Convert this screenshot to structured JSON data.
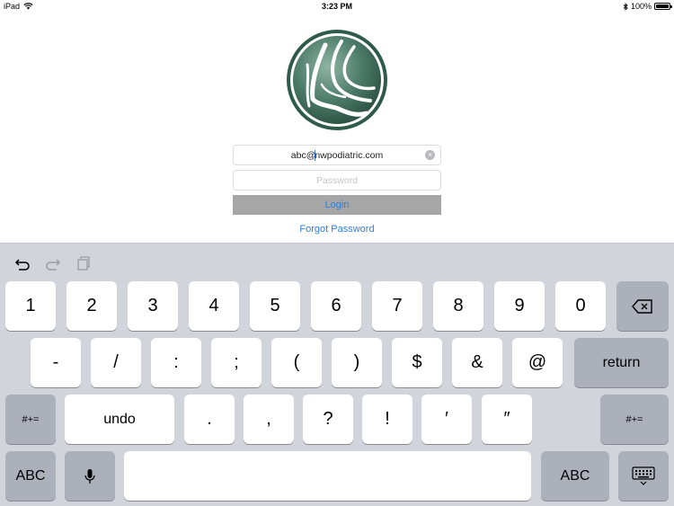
{
  "status_bar": {
    "device": "iPad",
    "time": "3:23 PM",
    "battery": "100%"
  },
  "login_form": {
    "email_before_caret": "abc@",
    "email_after_caret": "nwpodiatric.com",
    "password_placeholder": "Password",
    "login_label": "Login",
    "forgot_label": "Forgot Password"
  },
  "colors": {
    "accent": "#2f7fd8",
    "logo_green": "#3f6e5c",
    "keyboard_bg": "#d1d4da",
    "function_key": "#abb0bb"
  },
  "keyboard": {
    "toolbar_icons": [
      "undo-icon",
      "redo-icon",
      "paste-icon"
    ],
    "row1": [
      "1",
      "2",
      "3",
      "4",
      "5",
      "6",
      "7",
      "8",
      "9",
      "0"
    ],
    "row2": [
      "-",
      "/",
      ":",
      ";",
      "(",
      ")",
      "$",
      "&",
      "@"
    ],
    "return_label": "return",
    "row3_left": "#+=",
    "undo_label": "undo",
    "row3": [
      ".",
      ",",
      "?",
      "!",
      "′",
      "″"
    ],
    "row3_right": "#+=",
    "abc_label": "ABC",
    "mic_icon": "microphone-icon",
    "dismiss_icon": "keyboard-dismiss-icon",
    "delete_icon": "backspace-icon"
  }
}
